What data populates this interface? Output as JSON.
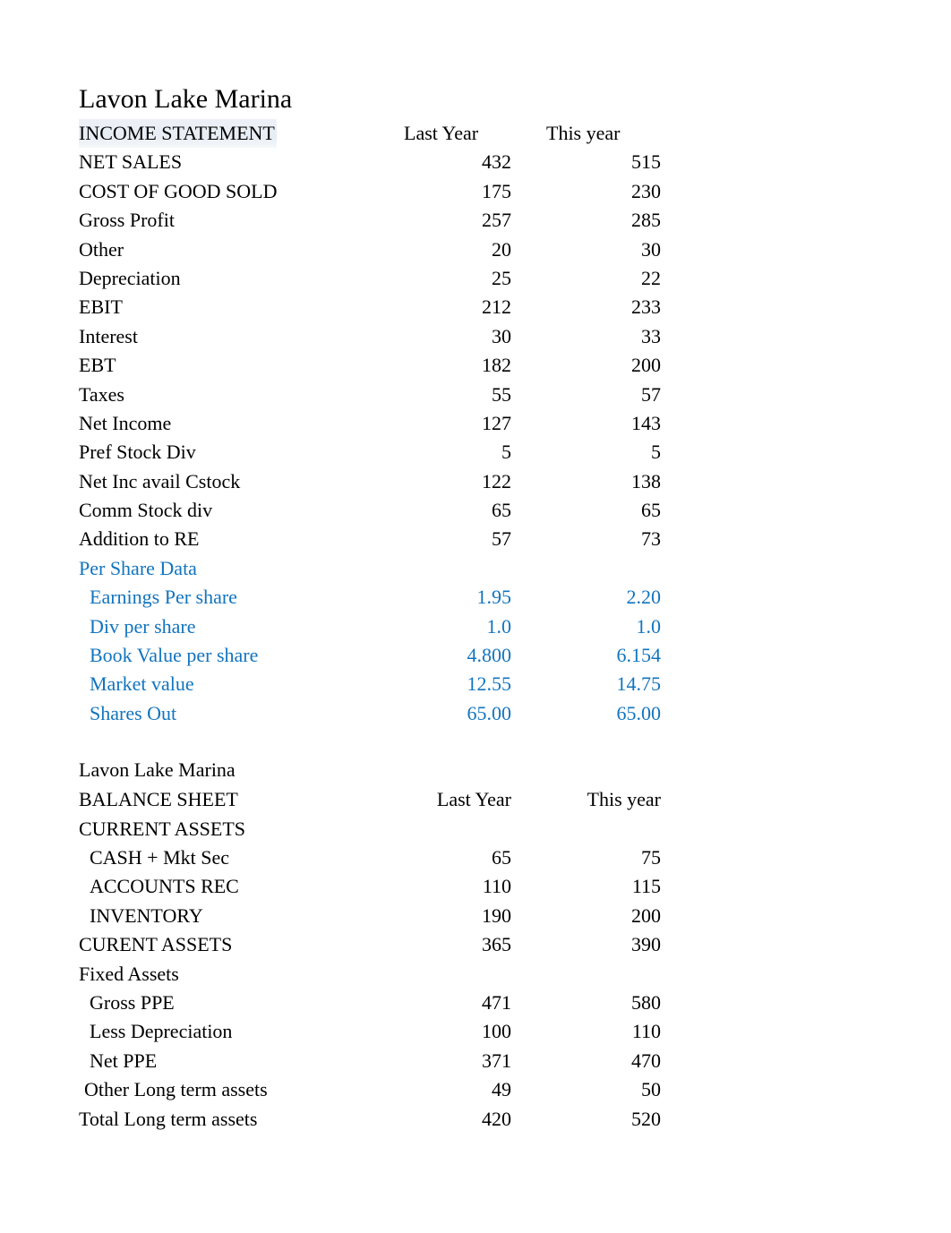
{
  "document": {
    "company": "Lavon Lake Marina",
    "accent_blue": "#1274be",
    "title_band_green": "#e9f1dd",
    "title_band_blue": "#e2ecf3"
  },
  "income_statement": {
    "company_title": "Lavon Lake Marina",
    "section_label": "INCOME STATEMENT",
    "col1_header": "Last Year",
    "col2_header": "This year",
    "rows": [
      {
        "label": "NET SALES",
        "last": "432",
        "this": "515"
      },
      {
        "label": "COST OF GOOD SOLD",
        "last": "175",
        "this": "230"
      },
      {
        "label": "Gross Profit",
        "last": "257",
        "this": "285"
      },
      {
        "label": "Other",
        "last": "20",
        "this": "30"
      },
      {
        "label": "Depreciation",
        "last": "25",
        "this": "22"
      },
      {
        "label": "EBIT",
        "last": "212",
        "this": "233"
      },
      {
        "label": "Interest",
        "last": "30",
        "this": "33"
      },
      {
        "label": "EBT",
        "last": "182",
        "this": "200"
      },
      {
        "label": "Taxes",
        "last": "55",
        "this": "57"
      },
      {
        "label": "Net Income",
        "last": "127",
        "this": "143"
      },
      {
        "label": "Pref Stock Div",
        "last": "5",
        "this": "5"
      },
      {
        "label": "Net Inc avail Cstock",
        "last": "122",
        "this": "138"
      },
      {
        "label": "Comm Stock div",
        "last": "65",
        "this": "65"
      },
      {
        "label": "Addition to RE",
        "last": "57",
        "this": "73"
      }
    ],
    "per_share": {
      "heading": "Per Share Data",
      "rows": [
        {
          "label": "Earnings Per share",
          "last": "1.95",
          "this": "2.20"
        },
        {
          "label": "Div per share",
          "last": "1.0",
          "this": "1.0"
        },
        {
          "label": "Book Value per share",
          "last": "4.800",
          "this": "6.154"
        },
        {
          "label": "Market value",
          "last": "12.55",
          "this": "14.75"
        },
        {
          "label": "Shares Out",
          "last": "65.00",
          "this": "65.00"
        }
      ]
    }
  },
  "balance_sheet": {
    "company_title": "Lavon Lake Marina",
    "section_label": "BALANCE SHEET",
    "col1_header": "Last Year",
    "col2_header": "This year",
    "current_assets_heading": "CURRENT ASSETS",
    "current_assets": [
      {
        "label": "CASH + Mkt Sec",
        "last": "65",
        "this": "75"
      },
      {
        "label": "ACCOUNTS REC",
        "last": "110",
        "this": "115"
      },
      {
        "label": "INVENTORY",
        "last": "190",
        "this": "200"
      }
    ],
    "current_assets_total": {
      "label": "CURENT ASSETS",
      "last": "365",
      "this": "390"
    },
    "fixed_assets_heading": "Fixed Assets",
    "fixed_assets": [
      {
        "label": "Gross PPE",
        "last": "471",
        "this": "580"
      },
      {
        "label": "Less Depreciation",
        "last": "100",
        "this": "110"
      },
      {
        "label": "Net PPE",
        "last": "371",
        "this": "470"
      }
    ],
    "other_long_term": {
      "label": "Other Long term assets",
      "last": "49",
      "this": "50"
    },
    "total_long_term": {
      "label": "Total Long term assets",
      "last": "420",
      "this": "520"
    }
  }
}
